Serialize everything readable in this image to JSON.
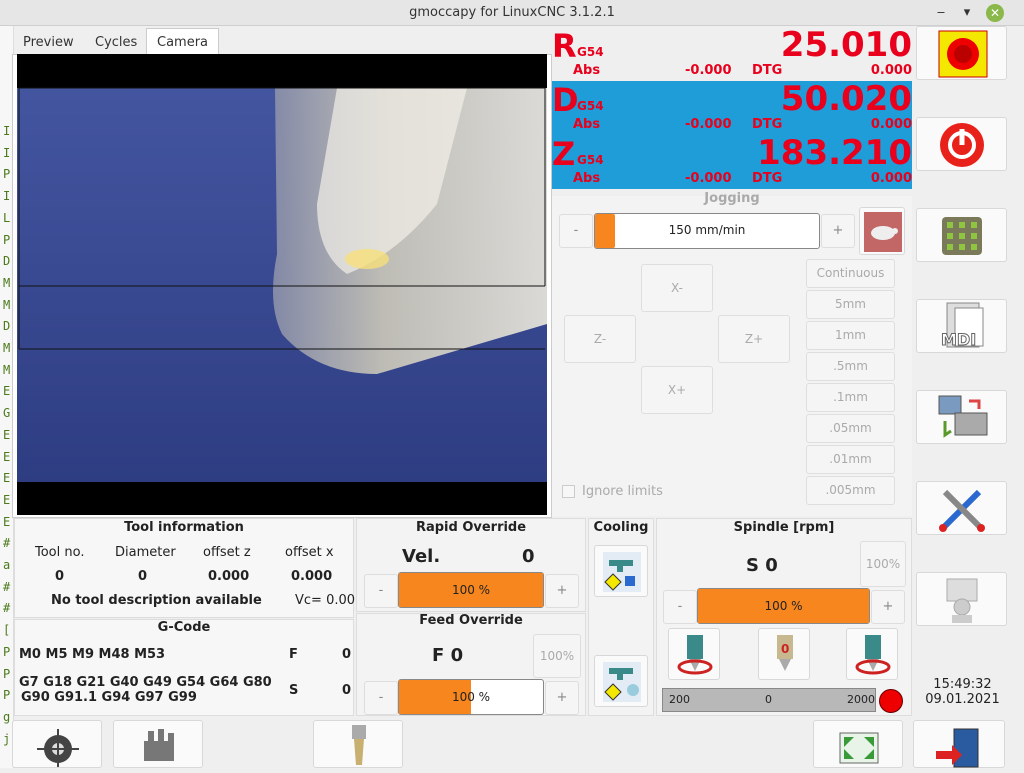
{
  "window": {
    "title": "gmoccapy for LinuxCNC  3.1.2.1"
  },
  "left_strip": [
    "I",
    "I",
    "P",
    "I",
    "L",
    "P",
    "D",
    "M",
    "M",
    "D",
    "M",
    "M",
    "E",
    "G",
    "E",
    "E",
    "E",
    "E",
    "E",
    "#",
    "a",
    "#",
    "#",
    "[",
    "P",
    "P",
    "P",
    "g",
    "j"
  ],
  "tabs": [
    {
      "label": "Preview"
    },
    {
      "label": "Cycles"
    },
    {
      "label": "Camera"
    }
  ],
  "dro": [
    {
      "axis": "R",
      "sub": "G54",
      "value": "25.010",
      "abs_label": "Abs",
      "abs_value": "-0.000",
      "dtg_label": "DTG",
      "dtg_value": "0.000",
      "bg": "#efefef"
    },
    {
      "axis": "D",
      "sub": "G54",
      "value": "50.020",
      "abs_label": "Abs",
      "abs_value": "-0.000",
      "dtg_label": "DTG",
      "dtg_value": "0.000",
      "bg": "#1f9dd9"
    },
    {
      "axis": "Z",
      "sub": "G54",
      "value": "183.210",
      "abs_label": "Abs",
      "abs_value": "-0.000",
      "dtg_label": "DTG",
      "dtg_value": "0.000",
      "bg": "#1f9dd9"
    }
  ],
  "jogging": {
    "title": "Jogging",
    "minus": "-",
    "plus": "+",
    "speed_text": "150 mm/min",
    "speed_fraction": 0.09,
    "buttons": {
      "xminus": "X-",
      "xplus": "X+",
      "zminus": "Z-",
      "zplus": "Z+"
    },
    "increments": [
      "Continuous",
      "5mm",
      "1mm",
      ".5mm",
      ".1mm",
      ".05mm",
      ".01mm",
      ".005mm"
    ],
    "ignore_limits": "Ignore limits"
  },
  "tool_info": {
    "title": "Tool information",
    "headers": [
      "Tool no.",
      "Diameter",
      "offset z",
      "offset x"
    ],
    "values": [
      "0",
      "0",
      "0.000",
      "0.000"
    ],
    "description": "No tool description available",
    "vc": "Vc= 0.00"
  },
  "gcode": {
    "title": "G-Code",
    "mcodes": "M0 M5 M9 M48 M53",
    "gcodes_line1": "G7 G18 G21 G40 G49 G54 G64 G80",
    "gcodes_line2": "G90 G91.1 G94 G97 G99",
    "f_label": "F",
    "f_value": "0",
    "s_label": "S",
    "s_value": "0"
  },
  "rapid_override": {
    "title": "Rapid Override",
    "label": "Vel.",
    "value": "0",
    "bar_text": "100 %",
    "fraction": 1.0,
    "minus": "-",
    "plus": "+"
  },
  "feed_override": {
    "title": "Feed Override",
    "label": "F  0",
    "percent_btn": "100%",
    "bar_text": "100 %",
    "fraction": 0.5,
    "minus": "-",
    "plus": "+"
  },
  "cooling": {
    "title": "Cooling"
  },
  "spindle": {
    "title": "Spindle [rpm]",
    "value": "S 0",
    "percent_btn": "100%",
    "bar_text": "100 %",
    "fraction": 1.0,
    "minus": "-",
    "plus": "+",
    "scale_min": "200",
    "scale_mid": "0",
    "scale_max": "2000"
  },
  "clock": {
    "time": "15:49:32",
    "date": "09.01.2021"
  },
  "colors": {
    "accent": "#f7861e",
    "dro_red": "#e8001c",
    "dro_blue": "#1f9dd9"
  }
}
